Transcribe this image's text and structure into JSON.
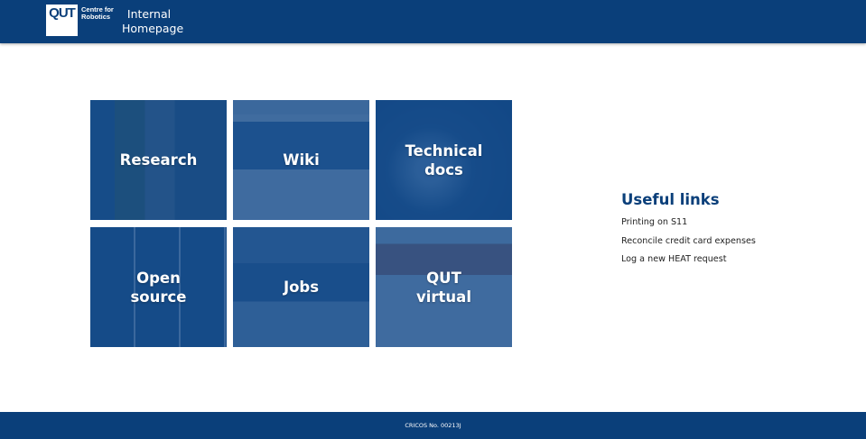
{
  "header": {
    "logo_mark": "QUT",
    "logo_subtitle": "Centre for Robotics",
    "site_title_line1": "Internal",
    "site_title_line2": "Homepage"
  },
  "tiles": [
    {
      "label_line1": "Research",
      "label_line2": ""
    },
    {
      "label_line1": "Wiki",
      "label_line2": ""
    },
    {
      "label_line1": "Technical",
      "label_line2": "docs"
    },
    {
      "label_line1": "Open",
      "label_line2": "source"
    },
    {
      "label_line1": "Jobs",
      "label_line2": ""
    },
    {
      "label_line1": "QUT",
      "label_line2": "virtual"
    }
  ],
  "useful_links": {
    "title": "Useful links",
    "items": [
      {
        "label": "Printing on S11"
      },
      {
        "label": "Reconcile credit card expenses"
      },
      {
        "label": "Log a new HEAT request"
      }
    ]
  },
  "footer": {
    "text": "CRICOS No. 00213J"
  },
  "colors": {
    "brand": "#0a3f7a",
    "tile_overlay": "#104687"
  }
}
